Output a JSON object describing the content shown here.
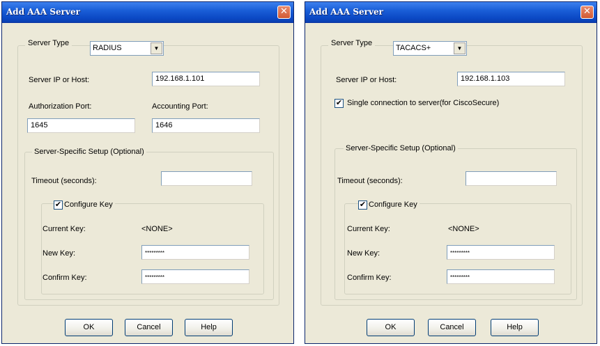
{
  "dialogs": [
    {
      "title": "Add AAA Server",
      "close_glyph": "✕",
      "server_type_label": "Server Type",
      "server_type_value": "RADIUS",
      "dropdown_arrow": "▼",
      "server_ip_label": "Server IP or Host:",
      "server_ip_value": "192.168.1.101",
      "authorization_port_label": "Authorization Port:",
      "authorization_port_value": "1645",
      "accounting_port_label": "Accounting Port:",
      "accounting_port_value": "1646",
      "server_specific_legend": "Server-Specific Setup (Optional)",
      "timeout_label": "Timeout (seconds):",
      "timeout_value": "",
      "configure_key_label": "Configure Key",
      "configure_key_checked": "✔",
      "current_key_label": "Current Key:",
      "current_key_value": "<NONE>",
      "new_key_label": "New Key:",
      "new_key_value": "*********",
      "confirm_key_label": "Confirm Key:",
      "confirm_key_value": "*********",
      "ok_label": "OK",
      "cancel_label": "Cancel",
      "help_label": "Help"
    },
    {
      "title": "Add AAA Server",
      "close_glyph": "✕",
      "server_type_label": "Server Type",
      "server_type_value": "TACACS+",
      "dropdown_arrow": "▼",
      "server_ip_label": "Server IP or Host:",
      "server_ip_value": "192.168.1.103",
      "single_connection_label": "Single connection to server(for CiscoSecure)",
      "single_connection_checked": "✔",
      "server_specific_legend": "Server-Specific Setup (Optional)",
      "timeout_label": "Timeout (seconds):",
      "timeout_value": "",
      "configure_key_label": "Configure Key",
      "configure_key_checked": "✔",
      "current_key_label": "Current Key:",
      "current_key_value": "<NONE>",
      "new_key_label": "New Key:",
      "new_key_value": "*********",
      "confirm_key_label": "Confirm Key:",
      "confirm_key_value": "*********",
      "ok_label": "OK",
      "cancel_label": "Cancel",
      "help_label": "Help"
    }
  ],
  "colors": {
    "dialog_background": "#ece9d8",
    "titlebar_blue": "#0b48c4",
    "close_button_red": "#d25a33"
  },
  "icons": [
    "close-icon",
    "dropdown-arrow-icon",
    "checkmark-icon"
  ]
}
